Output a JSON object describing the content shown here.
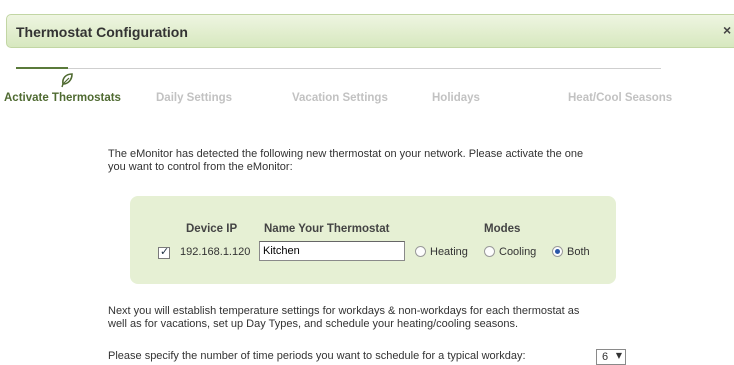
{
  "dialog": {
    "title": "Thermostat Configuration",
    "close_label": "×"
  },
  "wizard": {
    "steps": [
      {
        "label": "Activate Thermostats",
        "active": true
      },
      {
        "label": "Daily Settings",
        "active": false
      },
      {
        "label": "Vacation Settings",
        "active": false
      },
      {
        "label": "Holidays",
        "active": false
      },
      {
        "label": "Heat/Cool Seasons",
        "active": false
      }
    ],
    "active_icon": "leaf-icon"
  },
  "intro": {
    "line1": "The eMonitor has detected the following new thermostat on your network. Please activate the one",
    "line2": "you want to control from the eMonitor:"
  },
  "device_table": {
    "headers": {
      "ip": "Device IP",
      "name": "Name Your Thermostat",
      "modes": "Modes"
    },
    "rows": [
      {
        "selected": true,
        "ip": "192.168.1.120",
        "name": "Kitchen",
        "modes": [
          "Heating",
          "Cooling",
          "Both"
        ],
        "selected_mode": "Both"
      }
    ]
  },
  "next": {
    "line1": "Next you will establish temperature settings for workdays & non-workdays for each thermostat as",
    "line2": "well as for vacations, set up Day Types, and schedule your heating/cooling seasons."
  },
  "periods": {
    "prompt": "Please specify the number of time periods you want to schedule for a typical workday:",
    "value": "6",
    "arrow": "▼"
  },
  "colors": {
    "titlebar_bg": "#d7e8bf",
    "panel_bg": "#e6f0d4",
    "active_step": "#4f6a31",
    "inactive_step": "#c2c2c2"
  }
}
